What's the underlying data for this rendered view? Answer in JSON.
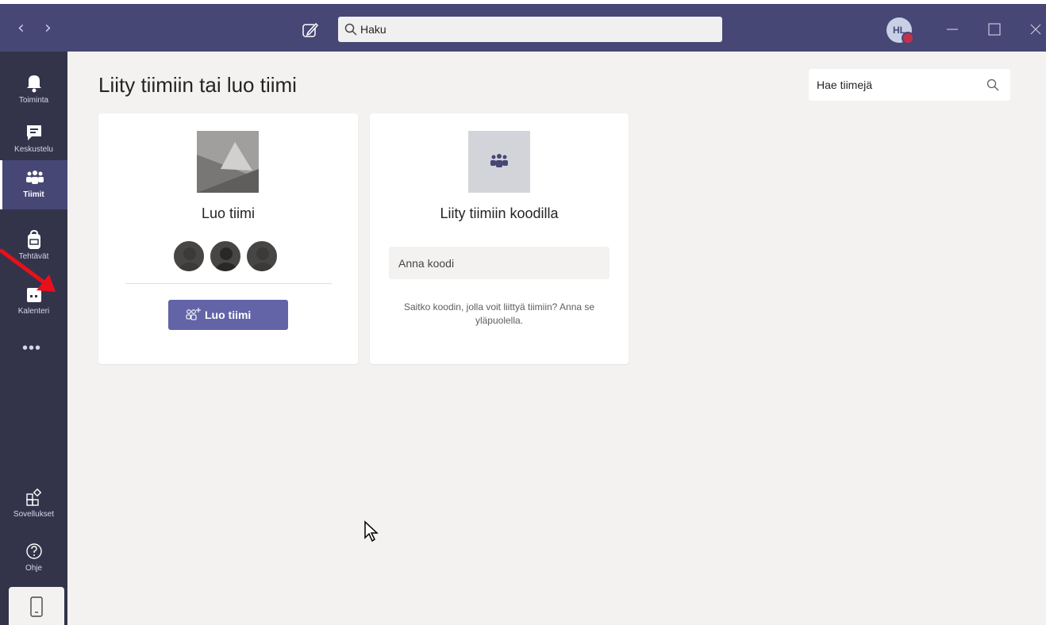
{
  "topbar": {
    "search_placeholder": "Haku",
    "avatar_initials": "HL",
    "accent_color": "#464775",
    "back_icon": "chevron-left-icon",
    "forward_icon": "chevron-right-icon",
    "compose_icon": "compose-icon",
    "window_controls": [
      "minimize-icon",
      "maximize-icon",
      "close-icon"
    ]
  },
  "rail": {
    "items": [
      {
        "label": "Toiminta",
        "icon": "bell-icon"
      },
      {
        "label": "Keskustelu",
        "icon": "chat-icon"
      },
      {
        "label": "Tiimit",
        "icon": "teams-icon",
        "active": true
      },
      {
        "label": "Tehtävät",
        "icon": "backpack-icon"
      },
      {
        "label": "Kalenteri",
        "icon": "calendar-icon"
      }
    ],
    "more_label": "•••",
    "bottom_items": [
      {
        "label": "Sovellukset",
        "icon": "apps-icon"
      },
      {
        "label": "Ohje",
        "icon": "help-icon"
      }
    ],
    "device_icon": "mobile-device-icon"
  },
  "main": {
    "title": "Liity tiimiin tai luo tiimi",
    "team_search_placeholder": "Hae tiimejä",
    "create_card": {
      "title": "Luo tiimi",
      "button_label": "Luo tiimi"
    },
    "join_card": {
      "title": "Liity tiimiin koodilla",
      "code_placeholder": "Anna koodi",
      "hint": "Saitko koodin, jolla voit liittyä tiimiin? Anna se yläpuolella."
    }
  },
  "colors": {
    "rail_bg": "#33344a",
    "button_bg": "#6264a7",
    "annotation_arrow": "#e8101a"
  }
}
